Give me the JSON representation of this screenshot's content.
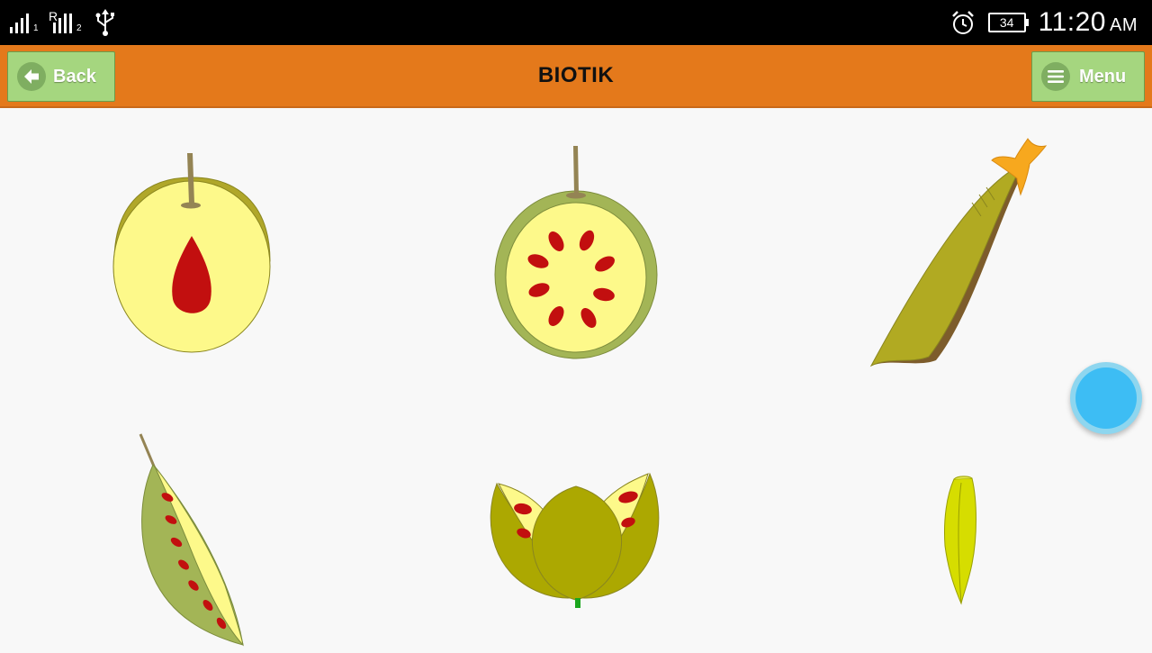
{
  "status_bar": {
    "sim1_label": "1",
    "sim2_roaming": "R",
    "sim2_label": "2",
    "battery_level": "34",
    "time": "11:20",
    "ampm": "AM"
  },
  "action_bar": {
    "back_label": "Back",
    "title": "BIOTIK",
    "menu_label": "Menu"
  },
  "colors": {
    "status_bar": "#000000",
    "action_bar": "#e4791b",
    "button": "#a5d67f",
    "background": "#f8f8f8",
    "fab": "#3dbdf4"
  },
  "items": [
    {
      "icon": "nutmeg-fruit-icon"
    },
    {
      "icon": "guava-cross-section-icon"
    },
    {
      "icon": "seed-pod-icon"
    },
    {
      "icon": "open-pea-pod-icon"
    },
    {
      "icon": "open-fruit-capsule-icon"
    },
    {
      "icon": "okra-icon"
    }
  ]
}
